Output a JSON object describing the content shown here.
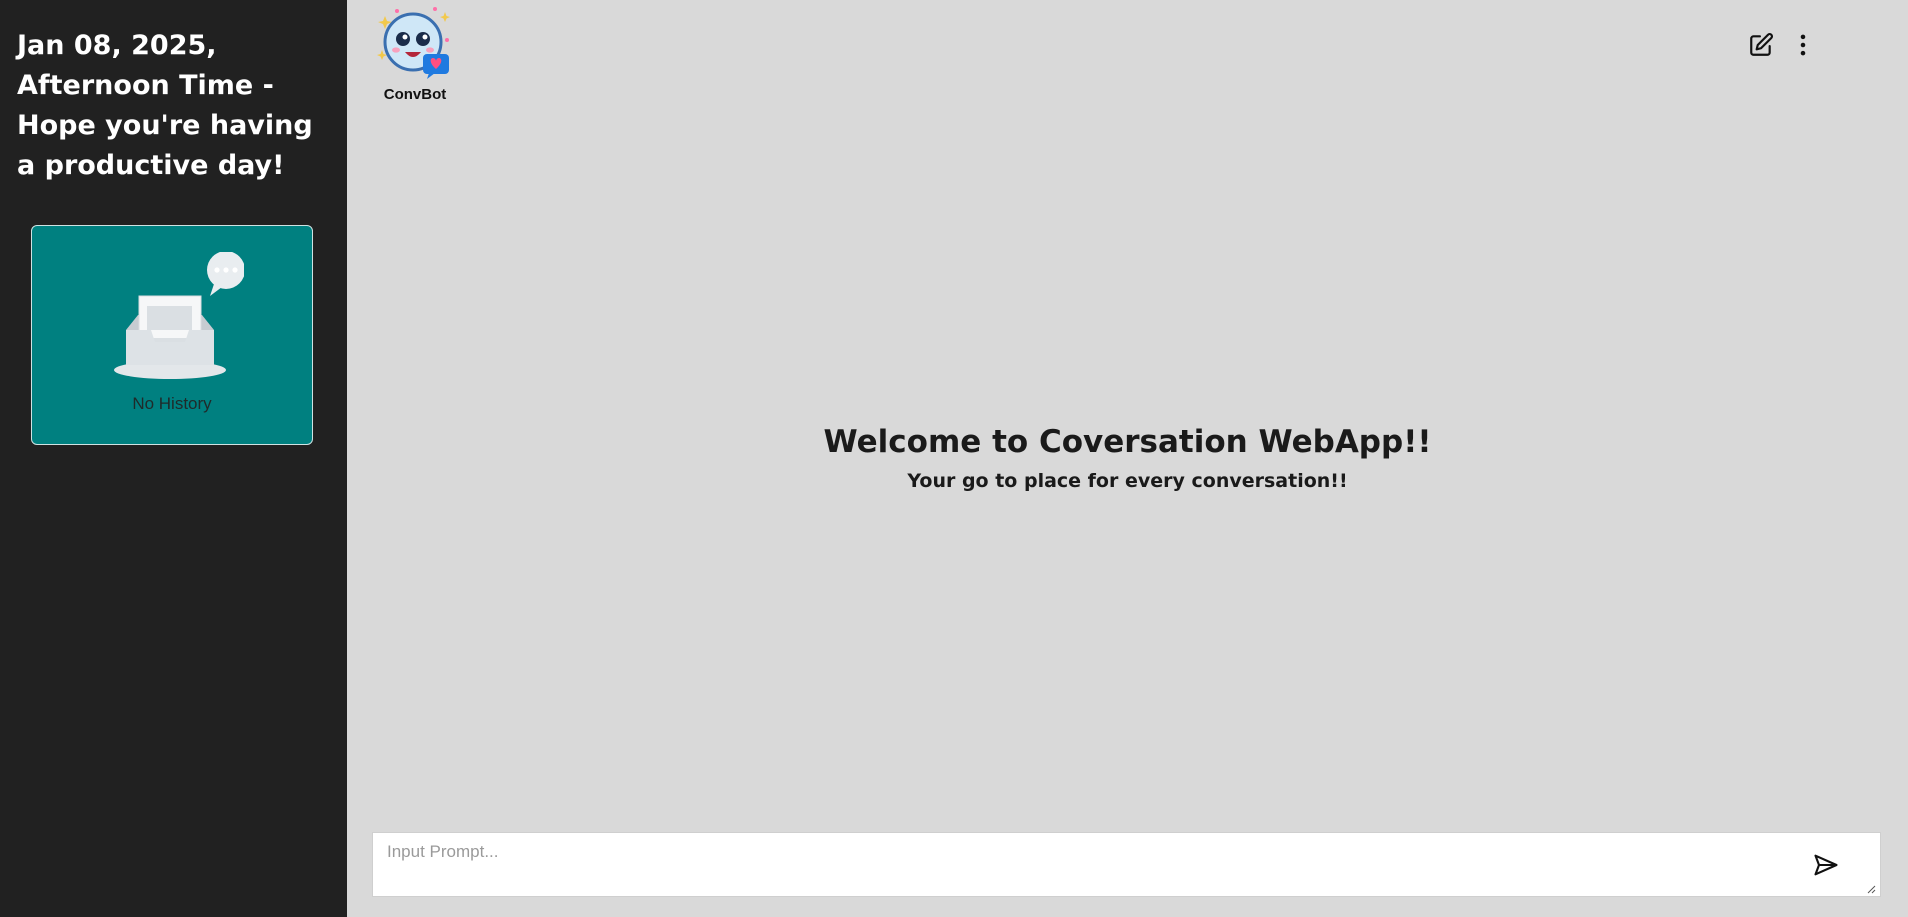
{
  "sidebar": {
    "greeting": "Jan 08, 2025, Afternoon Time - Hope you're having a productive day!",
    "history": {
      "empty_label": "No History",
      "card_color": "#008080"
    }
  },
  "header": {
    "brand_name": "ConvBot",
    "actions": [
      {
        "icon": "edit-icon",
        "label": "New chat"
      },
      {
        "icon": "more-vertical-icon",
        "label": "More options"
      }
    ]
  },
  "main": {
    "welcome_title": "Welcome to Coversation WebApp!!",
    "welcome_subtitle": "Your go to place for every conversation!!"
  },
  "prompt": {
    "placeholder": "Input Prompt...",
    "value": "",
    "send_icon": "send-icon"
  },
  "colors": {
    "sidebar_bg": "#212121",
    "main_bg": "#d9d9d9",
    "accent": "#008080"
  }
}
